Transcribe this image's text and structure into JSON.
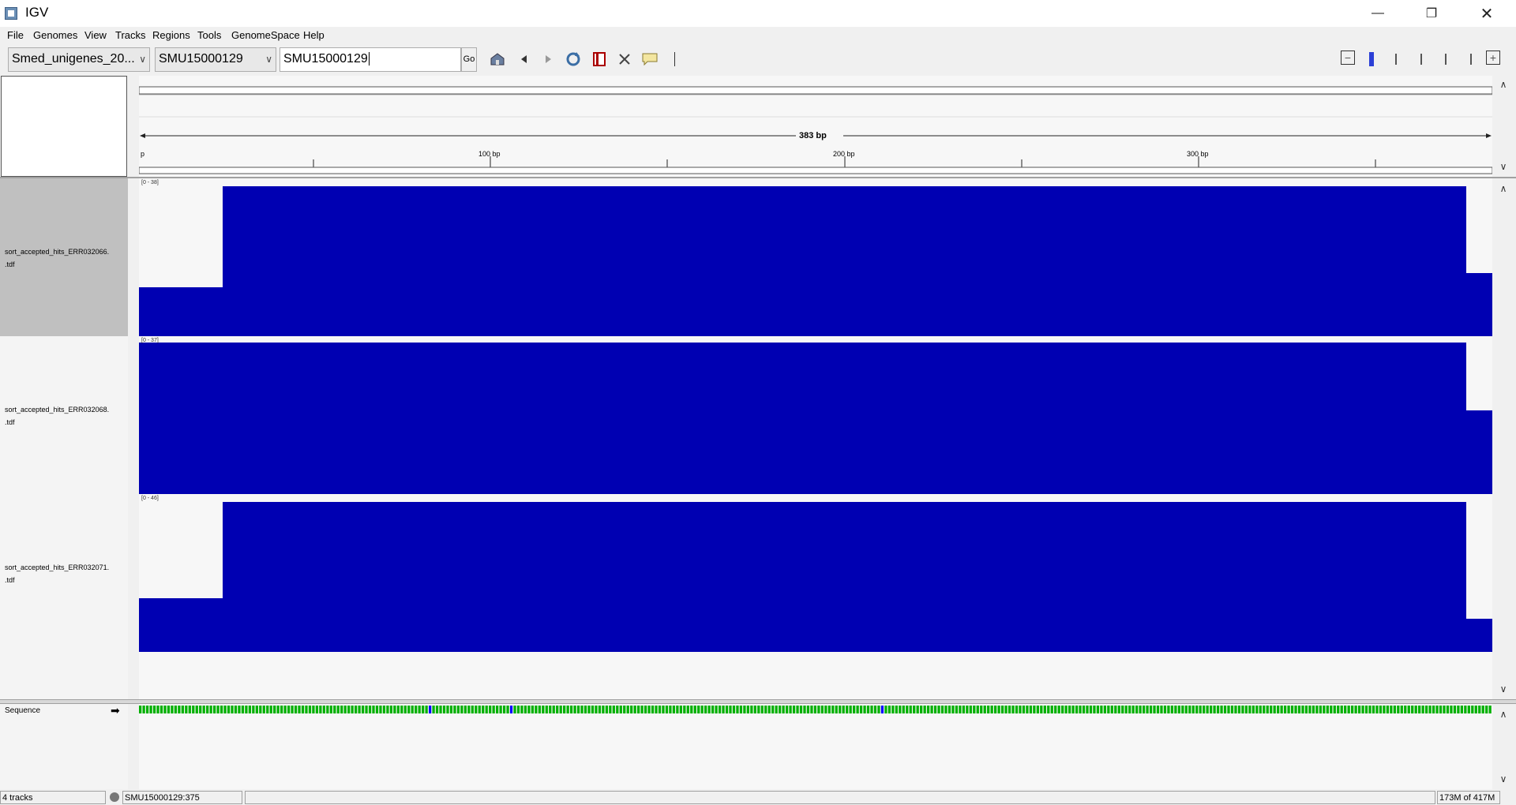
{
  "window": {
    "title": "IGV",
    "controls": [
      "minimize-icon",
      "restore-icon",
      "close-icon"
    ]
  },
  "menu": [
    "File",
    "Genomes",
    "View",
    "Tracks",
    "Regions",
    "Tools",
    "GenomeSpace",
    "Help"
  ],
  "toolbar": {
    "genome_select": "Smed_unigenes_20...",
    "chromosome_select": "SMU15000129",
    "locus_value": "SMU15000129",
    "go_label": "Go",
    "icons": [
      "home-icon",
      "back-icon",
      "forward-icon",
      "refresh-icon",
      "roi-icon",
      "fit-icon",
      "popup-icon"
    ]
  },
  "ruler": {
    "span_label": "383 bp",
    "tick_labels": [
      "p",
      "100 bp",
      "200 bp",
      "300 bp"
    ]
  },
  "tracks": [
    {
      "name_line1": "sort_accepted_hits_ERR032066.",
      "name_line2": ".tdf",
      "range": "[0 - 38]",
      "selected": true
    },
    {
      "name_line1": "sort_accepted_hits_ERR032068.",
      "name_line2": ".tdf",
      "range": "[0 - 37]",
      "selected": false
    },
    {
      "name_line1": "sort_accepted_hits_ERR032071.",
      "name_line2": ".tdf",
      "range": "[0 - 46]",
      "selected": false
    }
  ],
  "sequence": {
    "label": "Sequence",
    "strand_icon": "right-arrow-icon"
  },
  "status": {
    "tracks": "4 tracks",
    "position": "SMU15000129:375",
    "memory": "173M of 417M"
  },
  "colors": {
    "coverage": "#0000b2",
    "selected_track": "#c0c0c0",
    "base_A": "#00b000",
    "base_C": "#0000ff",
    "base_G": "#d18d00",
    "base_T": "#ff0000"
  }
}
